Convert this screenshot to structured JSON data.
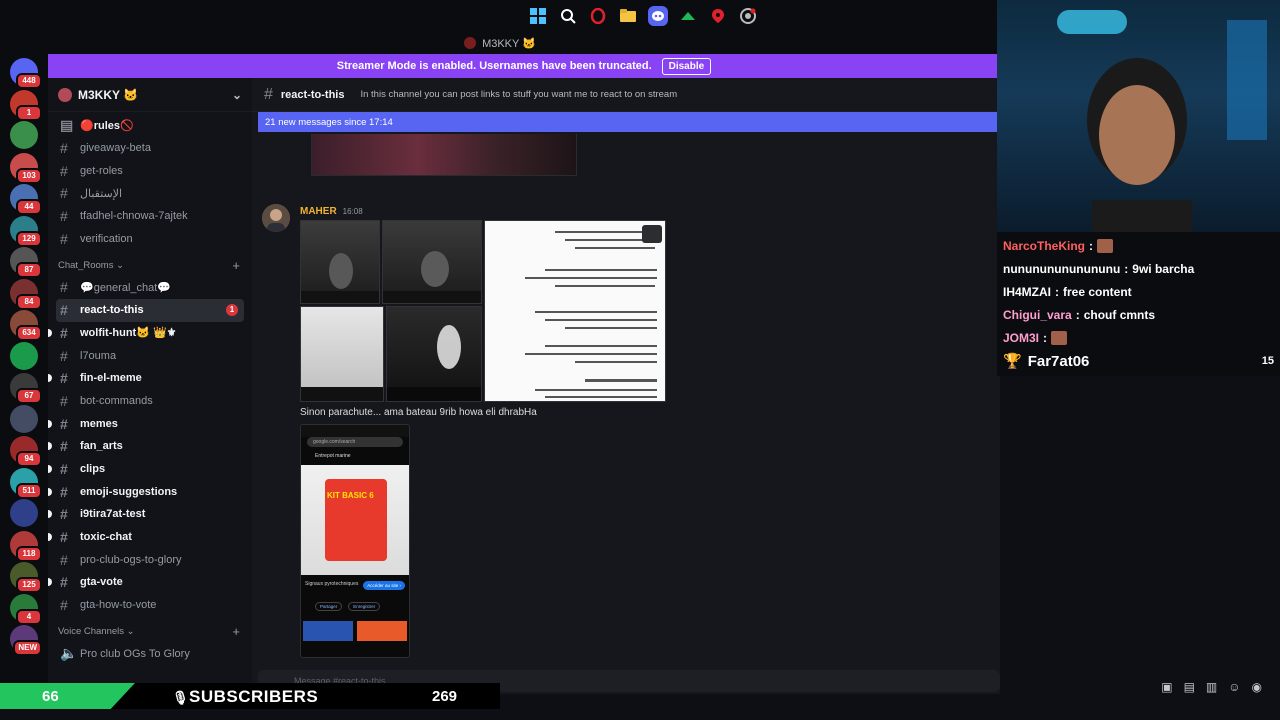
{
  "window": {
    "title": "M3KKY 🐱"
  },
  "taskbar": {
    "icons": [
      "windows-icon",
      "search-icon",
      "opera-icon",
      "folder-icon",
      "discord-icon",
      "app-icon",
      "map-pin-icon",
      "chrome-icon"
    ]
  },
  "banner": {
    "text": "Streamer Mode is enabled. Usernames have been truncated.",
    "button": "Disable"
  },
  "guilds": [
    {
      "badge": "448"
    },
    {
      "badge": "1"
    },
    {
      "badge": ""
    },
    {
      "badge": "103"
    },
    {
      "badge": "44"
    },
    {
      "badge": "129"
    },
    {
      "badge": "87"
    },
    {
      "badge": "84"
    },
    {
      "badge": "634"
    },
    {
      "badge": ""
    },
    {
      "badge": "67"
    },
    {
      "badge": ""
    },
    {
      "badge": "94"
    },
    {
      "badge": "511"
    },
    {
      "badge": ""
    },
    {
      "badge": "118"
    },
    {
      "badge": "125"
    },
    {
      "badge": "4"
    },
    {
      "badge": "NEW"
    }
  ],
  "server": {
    "name": "M3KKY 🐱"
  },
  "channels": {
    "top": [
      {
        "name": "🔴rules🚫",
        "bold": true,
        "icon": "rules-icon"
      },
      {
        "name": "giveaway-beta",
        "bold": false
      },
      {
        "name": "get-roles",
        "bold": false
      },
      {
        "name": "الإستقبال",
        "bold": false
      },
      {
        "name": "tfadhel-chnowa-7ajtek",
        "bold": false
      },
      {
        "name": "verification",
        "bold": false
      }
    ],
    "chat_category": "Chat_Rooms",
    "chat": [
      {
        "name": "💬general_chat💬",
        "bold": false,
        "bullet": false
      },
      {
        "name": "react-to-this",
        "bold": true,
        "active": true,
        "mention": "1"
      },
      {
        "name": "wolfit-hunt🐱 👑⚜",
        "bold": true,
        "bullet": true
      },
      {
        "name": "l7ouma",
        "bold": false
      },
      {
        "name": "fin-el-meme",
        "bold": true,
        "bullet": true
      },
      {
        "name": "bot-commands",
        "bold": false
      },
      {
        "name": "memes",
        "bold": true,
        "bullet": true
      },
      {
        "name": "fan_arts",
        "bold": true,
        "bullet": true
      },
      {
        "name": "clips",
        "bold": true,
        "bullet": true
      },
      {
        "name": "emoji-suggestions",
        "bold": true,
        "bullet": true
      },
      {
        "name": "i9tira7at-test",
        "bold": true,
        "bullet": true
      },
      {
        "name": "toxic-chat",
        "bold": true,
        "bullet": true
      },
      {
        "name": "pro-club-ogs-to-glory",
        "bold": false
      },
      {
        "name": "gta-vote",
        "bold": true,
        "bullet": true
      },
      {
        "name": "gta-how-to-vote",
        "bold": false
      }
    ],
    "voice_category": "Voice Channels",
    "voice": [
      {
        "name": "Pro club OGs To Glory"
      }
    ]
  },
  "main": {
    "channel": "react-to-this",
    "topic": "In this channel you can post links to stuff you want me to react to on stream",
    "new_messages": "21 new messages since 17:14",
    "message": {
      "author": "MAHER",
      "time": "16:08",
      "text": "Sinon parachute... ama bateau 9rib howa eli dhrabHa"
    },
    "phone": {
      "url": "google.com/search",
      "caption": "Entrepot marine",
      "product": "KIT BASIC 6",
      "product_sub": "Signaux pyrotechniques",
      "btn_visit": "Accéder au site ›",
      "btn_share": "Partager",
      "btn_save": "Enregistrer"
    },
    "composer_placeholder": "Message #react-to-this"
  },
  "stream_chat": [
    {
      "user": "NarcoTheKing",
      "msg": "",
      "emote": true,
      "style": "red"
    },
    {
      "user": "nunununununununu",
      "msg": "9wi barcha",
      "style": "white"
    },
    {
      "user": "IH4MZAI",
      "msg": "free content",
      "style": "white"
    },
    {
      "user": "Chigui_vara",
      "msg": "chouf cmnts",
      "style": "pink"
    },
    {
      "user": "JOM3I",
      "msg": "",
      "emote": true,
      "style": "pink"
    }
  ],
  "top_chatter": {
    "name": "Far7at06",
    "count": "15"
  },
  "sub_goal": {
    "current": "66",
    "label": "SUBSCRIBERS",
    "goal": "269",
    "progress": 0.245
  }
}
